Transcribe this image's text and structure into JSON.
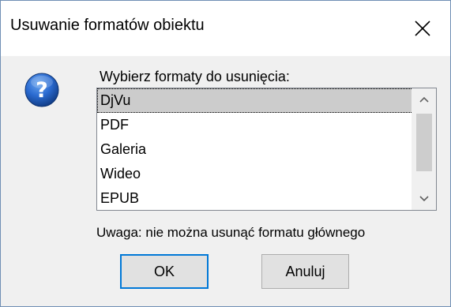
{
  "window": {
    "title": "Usuwanie formatów obiektu"
  },
  "dialog": {
    "prompt": "Wybierz formaty do usunięcia:",
    "formats": [
      {
        "label": "DjVu",
        "selected": true
      },
      {
        "label": "PDF",
        "selected": false
      },
      {
        "label": "Galeria",
        "selected": false
      },
      {
        "label": "Wideo",
        "selected": false
      },
      {
        "label": "EPUB",
        "selected": false
      }
    ],
    "note": "Uwaga: nie można usunąć formatu głównego",
    "ok_label": "OK",
    "cancel_label": "Anuluj"
  },
  "icons": {
    "dialog_icon": "question-icon",
    "close": "close-icon",
    "scroll_up": "chevron-up-icon",
    "scroll_down": "chevron-down-icon"
  },
  "colors": {
    "selection": "#cccccc",
    "default_button_border": "#0078d7",
    "icon_blue": "#1e5cb8"
  }
}
